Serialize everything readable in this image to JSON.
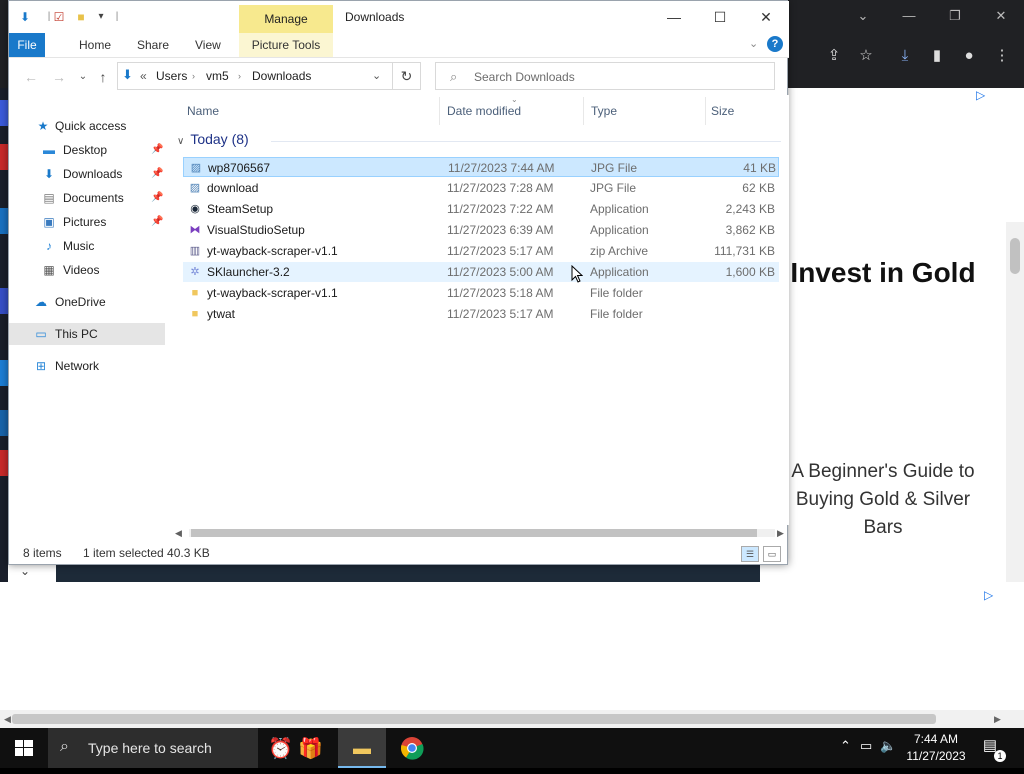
{
  "explorer": {
    "window_title": "Downloads",
    "manage_tab": "Manage",
    "ribbon_tabs": [
      "File",
      "Home",
      "Share",
      "View"
    ],
    "picture_tools": "Picture Tools",
    "breadcrumb": {
      "overflow": "«",
      "parts": [
        "Users",
        "vm5",
        "Downloads"
      ]
    },
    "search_placeholder": "Search Downloads",
    "nav": {
      "quick_access": "Quick access",
      "items": [
        "Desktop",
        "Downloads",
        "Documents",
        "Pictures",
        "Music",
        "Videos"
      ],
      "onedrive": "OneDrive",
      "this_pc": "This PC",
      "network": "Network"
    },
    "columns": [
      "Name",
      "Date modified",
      "Type",
      "Size"
    ],
    "group": "Today (8)",
    "files": [
      {
        "name": "wp8706567",
        "date": "11/27/2023 7:44 AM",
        "type": "JPG File",
        "size": "41 KB",
        "icon": "jpg-file-icon"
      },
      {
        "name": "download",
        "date": "11/27/2023 7:28 AM",
        "type": "JPG File",
        "size": "62 KB",
        "icon": "jpg-file-icon"
      },
      {
        "name": "SteamSetup",
        "date": "11/27/2023 7:22 AM",
        "type": "Application",
        "size": "2,243 KB",
        "icon": "steam-icon"
      },
      {
        "name": "VisualStudioSetup",
        "date": "11/27/2023 6:39 AM",
        "type": "Application",
        "size": "3,862 KB",
        "icon": "visual-studio-icon"
      },
      {
        "name": "yt-wayback-scraper-v1.1",
        "date": "11/27/2023 5:17 AM",
        "type": "zip Archive",
        "size": "111,731 KB",
        "icon": "zip-icon"
      },
      {
        "name": "SKlauncher-3.2",
        "date": "11/27/2023 5:00 AM",
        "type": "Application",
        "size": "1,600 KB",
        "icon": "sklauncher-icon"
      },
      {
        "name": "yt-wayback-scraper-v1.1",
        "date": "11/27/2023 5:18 AM",
        "type": "File folder",
        "size": "",
        "icon": "folder-icon"
      },
      {
        "name": "ytwat",
        "date": "11/27/2023 5:17 AM",
        "type": "File folder",
        "size": "",
        "icon": "folder-icon"
      }
    ],
    "status": {
      "count": "8 items",
      "selection": "1 item selected  40.3 KB"
    }
  },
  "browser": {
    "ad": {
      "title": "Invest in Gold",
      "subtitle": "A Beginner's Guide to Buying Gold & Silver Bars"
    }
  },
  "taskbar": {
    "search_placeholder": "Type here to search",
    "time": "7:44 AM",
    "date": "11/27/2023",
    "notification_count": "1"
  },
  "colors": {
    "file_tab": "#1979ca",
    "manage_tab": "#f7e98e",
    "selection": "#cce8ff",
    "taskbar": "#101010"
  }
}
